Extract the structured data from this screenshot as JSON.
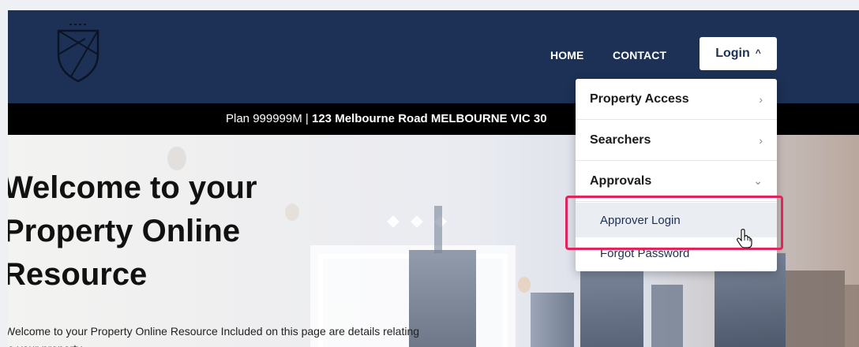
{
  "nav": {
    "home": "HOME",
    "contact": "CONTACT",
    "login": "Login",
    "login_caret": "^"
  },
  "address": {
    "plan": "Plan 999999M",
    "separator": "|",
    "street": "123 Melbourne Road MELBOURNE VIC 30"
  },
  "hero": {
    "title_line1": "Welcome to your",
    "title_line2": "Property Online",
    "title_line3": "Resource",
    "intro": "Welcome to your Property Online Resource Included on this page are details relating to your property."
  },
  "dropdown": {
    "items": [
      {
        "label": "Property Access",
        "chevron": "›"
      },
      {
        "label": "Searchers",
        "chevron": "›"
      },
      {
        "label": "Approvals",
        "chevron": "⌄"
      }
    ],
    "submenu": [
      {
        "label": "Approver Login"
      },
      {
        "label": "Forgot Password"
      }
    ]
  },
  "colors": {
    "header": "#1c3155",
    "address_bar": "#000000",
    "highlight": "#e0245e",
    "submenu_hover": "#eaedf2"
  },
  "icons": {
    "logo": "shield-logo-icon",
    "cursor": "hand-pointer-cursor-icon"
  }
}
